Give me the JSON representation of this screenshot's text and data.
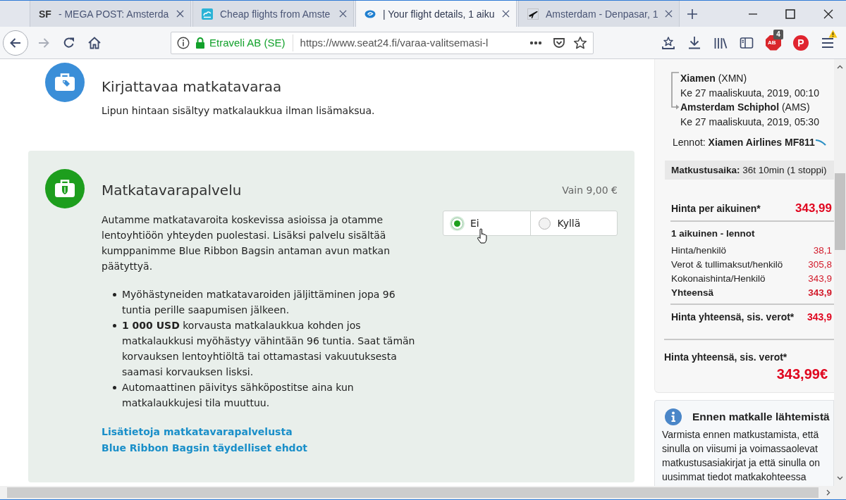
{
  "browser": {
    "tabs": [
      {
        "kind": "text",
        "favicon_text": "SF",
        "title": "- MEGA POST: Amsterda",
        "selected": false
      },
      {
        "kind": "cloud",
        "title": "Cheap flights from Amste",
        "selected": false
      },
      {
        "kind": "oval",
        "title": "| Your flight details, 1 aiku",
        "selected": true
      },
      {
        "kind": "plane",
        "title": "Amsterdam - Denpasar, 1",
        "selected": false
      }
    ],
    "forward_disabled": true,
    "address_bar": {
      "identity": "Etraveli AB (SE)",
      "url": "https://www.seat24.fi/varaa-valitsemasi-l"
    },
    "extensions": [
      {
        "kind": "adblock",
        "label": "AB",
        "badge": "4"
      },
      {
        "kind": "pin",
        "label": "P"
      }
    ],
    "menu_alert": true
  },
  "included_baggage": {
    "title": "Kirjattavaa matkatavaraa",
    "text": "Lipun hintaan sisältyy matkalaukkua ilman lisämaksua."
  },
  "baggage_service": {
    "title": "Matkatavarapalvelu",
    "price": "Vain 9,00 €",
    "description": "Autamme matkatavaroita koskevissa asioissa ja otamme lentoyhtiöön yhteyden puolestasi. Lisäksi palvelu sisältää kumppanimme Blue Ribbon Bagsin antaman avun matkan päätyttyä.",
    "options": [
      {
        "label": "Ei",
        "selected": true
      },
      {
        "label": "Kyllä",
        "selected": false
      }
    ],
    "benefits": [
      "Myöhästyneiden matkatavaroiden jäljittäminen jopa 96 tuntia perille saapumisen jälkeen.",
      "**1 000 USD** korvausta matkalaukkua kohden jos matkalaukkusi myöhästyy vähintään 96 tuntia. Saat tämän korvauksen lentoyhtiöltä tai ottamastasi vakuutuksesta saamasi korvauksen lisksi.",
      "Automaattinen päivitys sähköpostitse aina kun matkalaukkujesi tila muuttuu."
    ],
    "links": [
      "Lisätietoja matkatavarapalvelusta",
      "Blue Ribbon Bagsin täydelliset ehdot"
    ]
  },
  "summary": {
    "stops": [
      {
        "place": "**Xiamen** (XMN)",
        "time": "Ke 27 maaliskuuta, 2019, 00:10"
      },
      {
        "place": "**Amsterdam Schiphol** (AMS)",
        "time": "Ke 27 maaliskuuta, 2019, 05:30"
      }
    ],
    "flights": "Lennot: **Xiamen Airlines MF811**",
    "duration": "**Matkustusaika:** 36t 10min (1 stoppi)",
    "price_per_adult": {
      "label": "Hinta per aikuinen*",
      "value": "343,99"
    },
    "breakdown_title": "1 aikuinen - lennot",
    "breakdown": [
      {
        "kind": "item",
        "label": "Hinta/henkilö",
        "value": "38,1"
      },
      {
        "kind": "item",
        "label": "Verot & tullimaksut/henkilö",
        "value": "305,8"
      },
      {
        "kind": "item",
        "label": "Kokonaishinta/Henkilö",
        "value": "343,9"
      },
      {
        "kind": "total",
        "label": "Yhteensä",
        "value": "343,9"
      }
    ],
    "subtotal": {
      "label": "Hinta yhteensä, sis. verot*",
      "value": "343,9"
    },
    "total": {
      "label": "Hinta yhteensä, sis. verot*",
      "value": "343,99€"
    }
  },
  "notice": {
    "title": "Ennen matkalle lähtemistä",
    "text": "Varmista ennen matkustamista, että sinulla on viisumi ja voimassaolevat matkustusasiakirjat ja että sinulla on uusimmat tiedot matkakohteessa"
  }
}
